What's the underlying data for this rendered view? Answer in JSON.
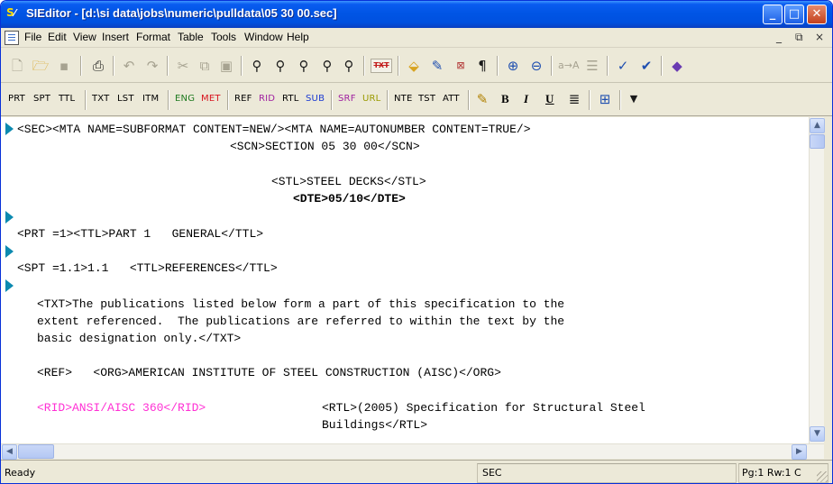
{
  "window": {
    "title": "SIEditor - [d:\\si data\\jobs\\numeric\\pulldata\\05 30 00.sec]",
    "app_icon_label": "S",
    "controls": {
      "minimize": "_",
      "maximize": "□",
      "close": "✕"
    }
  },
  "menubar": {
    "items": [
      "File",
      "Edit",
      "View",
      "Insert",
      "Format",
      "Table",
      "Tools",
      "Window",
      "Help"
    ],
    "mdi_controls": [
      "_",
      "⧉",
      "×"
    ]
  },
  "toolbar1": {
    "icons": [
      "new-icon",
      "open-icon",
      "save-icon",
      "print-icon",
      "undo-icon",
      "redo-icon",
      "cut-icon",
      "copy-icon",
      "paste-icon",
      "find-icon",
      "find-next-icon",
      "replace-icon",
      "find-tag-icon",
      "find-tag-next-icon",
      "txt-icon",
      "tag-icon",
      "tag-edit-icon",
      "txt-split-icon",
      "pilcrow-icon",
      "zoom-in-icon",
      "zoom-out-icon",
      "font-size-icon",
      "align-icon",
      "spellcheck-icon",
      "check-icon",
      "settings-icon"
    ],
    "txt_chip": "TXT"
  },
  "toolbar2": {
    "tags": [
      {
        "label": "PRT",
        "color": "black"
      },
      {
        "label": "SPT",
        "color": "black"
      },
      {
        "label": "TTL",
        "color": "black"
      },
      {
        "label": "TXT",
        "color": "black"
      },
      {
        "label": "LST",
        "color": "black"
      },
      {
        "label": "ITM",
        "color": "black"
      },
      {
        "label": "ENG",
        "color": "green"
      },
      {
        "label": "MET",
        "color": "red"
      },
      {
        "label": "REF",
        "color": "black"
      },
      {
        "label": "RID",
        "color": "purple"
      },
      {
        "label": "RTL",
        "color": "black"
      },
      {
        "label": "SUB",
        "color": "blue"
      },
      {
        "label": "SRF",
        "color": "purple"
      },
      {
        "label": "URL",
        "color": "olive"
      },
      {
        "label": "NTE",
        "color": "black"
      },
      {
        "label": "TST",
        "color": "black"
      },
      {
        "label": "ATT",
        "color": "black"
      }
    ],
    "format": {
      "bold": "B",
      "italic": "I",
      "underline": "U"
    }
  },
  "editor": {
    "lines": [
      "<SEC><MTA NAME=SUBFORMAT CONTENT=NEW/><MTA NAME=AUTONUMBER CONTENT=TRUE/>",
      "<SCN>SECTION 05 30 00</SCN>",
      "<STL>STEEL DECKS</STL>",
      "<DTE>05/10</DTE>",
      "<PRT =1><TTL>PART 1   GENERAL</TTL>",
      "<SPT =1.1>1.1   <TTL>REFERENCES</TTL>",
      "<TXT>The publications listed below form a part of this specification to the",
      "extent referenced.  The publications are referred to within the text by the",
      "basic designation only.</TXT>",
      "<REF>   <ORG>AMERICAN INSTITUTE OF STEEL CONSTRUCTION (AISC)</ORG>",
      "<RID>ANSI/AISC 360</RID>",
      "<RTL>(2005) Specification for Structural Steel",
      "Buildings</RTL>"
    ]
  },
  "statusbar": {
    "left": "Ready",
    "mode": "SEC",
    "position": "Pg:1 Rw:1 C"
  },
  "colors": {
    "titlebar": "#0055e5",
    "chrome": "#ece9d8",
    "marker": "#0c8ab0",
    "rid_tag": "#ff2fd4"
  }
}
